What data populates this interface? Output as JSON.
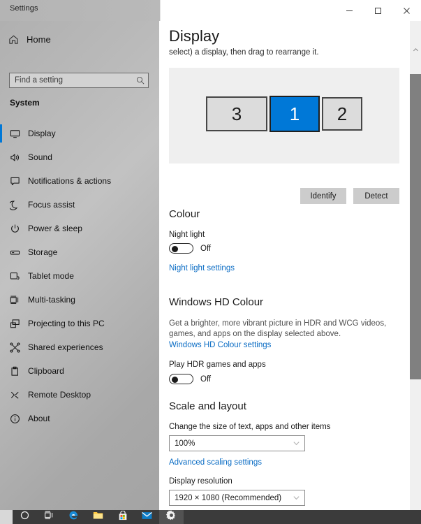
{
  "window": {
    "title": "Settings",
    "controls": [
      {
        "name": "minimize",
        "label": "Minimise"
      },
      {
        "name": "maximize",
        "label": "Maximise"
      },
      {
        "name": "close",
        "label": "Close"
      }
    ]
  },
  "sidebar": {
    "home_label": "Home",
    "home_icon": "home-icon",
    "search": {
      "placeholder": "Find a setting",
      "value": "",
      "icon": "search-icon"
    },
    "group_title": "System",
    "items": [
      {
        "label": "Display",
        "icon": "monitor-icon",
        "selected": true
      },
      {
        "label": "Sound",
        "icon": "speaker-icon",
        "selected": false
      },
      {
        "label": "Notifications & actions",
        "icon": "notification-icon",
        "selected": false
      },
      {
        "label": "Focus assist",
        "icon": "moon-icon",
        "selected": false
      },
      {
        "label": "Power & sleep",
        "icon": "power-icon",
        "selected": false
      },
      {
        "label": "Storage",
        "icon": "storage-icon",
        "selected": false
      },
      {
        "label": "Tablet mode",
        "icon": "tablet-icon",
        "selected": false
      },
      {
        "label": "Multi-tasking",
        "icon": "multitask-icon",
        "selected": false
      },
      {
        "label": "Projecting to this PC",
        "icon": "projecting-icon",
        "selected": false
      },
      {
        "label": "Shared experiences",
        "icon": "shared-icon",
        "selected": false
      },
      {
        "label": "Clipboard",
        "icon": "clipboard-icon",
        "selected": false
      },
      {
        "label": "Remote Desktop",
        "icon": "remote-desktop-icon",
        "selected": false
      },
      {
        "label": "About",
        "icon": "info-icon",
        "selected": false
      }
    ]
  },
  "main": {
    "title": "Display",
    "subtitle": "select) a display, then drag to rearrange it.",
    "monitors": [
      {
        "number": "3",
        "selected": false
      },
      {
        "number": "1",
        "selected": true
      },
      {
        "number": "2",
        "selected": false
      }
    ],
    "identify_button": "Identify",
    "detect_button": "Detect",
    "colour": {
      "heading": "Colour",
      "night_light_label": "Night light",
      "night_light_state": "Off",
      "night_light_link": "Night light settings"
    },
    "hdr": {
      "heading": "Windows HD Colour",
      "description_line1": "Get a brighter, more vibrant picture in HDR and WCG videos,",
      "description_line2": "games, and apps on the display selected above.",
      "link": "Windows HD Colour settings",
      "play_hdr_label": "Play HDR games and apps",
      "play_hdr_state": "Off"
    },
    "scale": {
      "heading": "Scale and layout",
      "size_label": "Change the size of text, apps and other items",
      "size_value": "100%",
      "advanced_link": "Advanced scaling settings",
      "resolution_label": "Display resolution",
      "resolution_value": "1920 × 1080 (Recommended)"
    }
  },
  "scrollbar": {
    "up_arrow_icon": "chevron-up-icon"
  },
  "taskbar": {
    "items": [
      {
        "name": "cortana",
        "icon": "circle-icon"
      },
      {
        "name": "task-view",
        "icon": "task-view-icon"
      },
      {
        "name": "edge",
        "icon": "edge-icon"
      },
      {
        "name": "file-explorer",
        "icon": "folder-icon"
      },
      {
        "name": "microsoft-store",
        "icon": "store-icon"
      },
      {
        "name": "mail",
        "icon": "mail-icon"
      },
      {
        "name": "settings",
        "icon": "gear-icon"
      }
    ]
  },
  "colors": {
    "accent": "#0078d7",
    "link": "#0a6cc4",
    "taskbar": "#3b3b3b"
  }
}
